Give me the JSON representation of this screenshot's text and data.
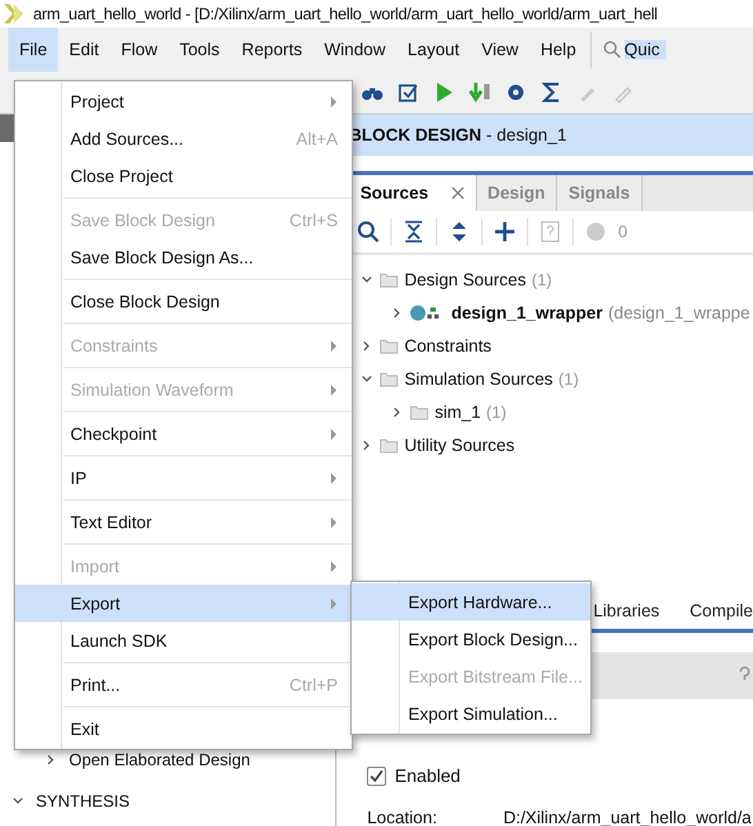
{
  "window": {
    "title": "arm_uart_hello_world - [D:/Xilinx/arm_uart_hello_world/arm_uart_hello_world/arm_uart_hell"
  },
  "menubar": [
    {
      "label": "File",
      "selected": true
    },
    {
      "label": "Edit",
      "selected": false
    },
    {
      "label": "Flow",
      "selected": false
    },
    {
      "label": "Tools",
      "selected": false
    },
    {
      "label": "Reports",
      "selected": false
    },
    {
      "label": "Window",
      "selected": false
    },
    {
      "label": "Layout",
      "selected": false
    },
    {
      "label": "View",
      "selected": false
    },
    {
      "label": "Help",
      "selected": false
    }
  ],
  "quick_access": {
    "placeholder": "Quic"
  },
  "flow_navigator": {
    "items": [
      {
        "label": "Open Elaborated Design",
        "kind": "task"
      },
      {
        "label": "SYNTHESIS",
        "kind": "section"
      }
    ]
  },
  "block_design_header": {
    "title": "BLOCK DESIGN",
    "name": "- design_1"
  },
  "sources_panel": {
    "tabs": [
      {
        "label": "Sources",
        "selected": true
      },
      {
        "label": "Design",
        "selected": false
      },
      {
        "label": "Signals",
        "selected": false
      }
    ],
    "error_count": "0",
    "tree": [
      {
        "label": "Design Sources",
        "count": "(1)",
        "expanded": true,
        "children": [
          {
            "label": "design_1_wrapper",
            "detail": "(design_1_wrappe",
            "kind": "module",
            "expanded": false
          }
        ]
      },
      {
        "label": "Constraints",
        "expanded": false
      },
      {
        "label": "Simulation Sources",
        "count": "(1)",
        "expanded": true,
        "children": [
          {
            "label": "sim_1",
            "count": "(1)",
            "kind": "folder",
            "expanded": false
          }
        ]
      },
      {
        "label": "Utility Sources",
        "expanded": false
      }
    ]
  },
  "lower_tabs": [
    {
      "label": "Libraries"
    },
    {
      "label": "Compile"
    }
  ],
  "properties": {
    "enabled": {
      "label": "Enabled",
      "checked": true
    },
    "location": {
      "label": "Location:",
      "value": "D:/Xilinx/arm_uart_hello_world/a"
    }
  },
  "file_menu": [
    {
      "label": "Project",
      "submenu": true,
      "disabled": false,
      "selected": false,
      "separator_before": false
    },
    {
      "label": "Add Sources...",
      "shortcut": "Alt+A",
      "submenu": false,
      "disabled": false,
      "selected": false,
      "separator_before": false
    },
    {
      "label": "Close Project",
      "submenu": false,
      "disabled": false,
      "selected": false,
      "separator_before": false
    },
    {
      "label": "Save Block Design",
      "shortcut": "Ctrl+S",
      "submenu": false,
      "disabled": true,
      "selected": false,
      "separator_before": true
    },
    {
      "label": "Save Block Design As...",
      "submenu": false,
      "disabled": false,
      "selected": false,
      "separator_before": false
    },
    {
      "label": "Close Block Design",
      "submenu": false,
      "disabled": false,
      "selected": false,
      "separator_before": true
    },
    {
      "label": "Constraints",
      "submenu": true,
      "disabled": true,
      "selected": false,
      "separator_before": true
    },
    {
      "label": "Simulation Waveform",
      "submenu": true,
      "disabled": true,
      "selected": false,
      "separator_before": true
    },
    {
      "label": "Checkpoint",
      "submenu": true,
      "disabled": false,
      "selected": false,
      "separator_before": true
    },
    {
      "label": "IP",
      "submenu": true,
      "disabled": false,
      "selected": false,
      "separator_before": true
    },
    {
      "label": "Text Editor",
      "submenu": true,
      "disabled": false,
      "selected": false,
      "separator_before": true
    },
    {
      "label": "Import",
      "submenu": true,
      "disabled": true,
      "selected": false,
      "separator_before": true
    },
    {
      "label": "Export",
      "submenu": true,
      "disabled": false,
      "selected": true,
      "separator_before": false
    },
    {
      "label": "Launch SDK",
      "submenu": false,
      "disabled": false,
      "selected": false,
      "separator_before": false
    },
    {
      "label": "Print...",
      "shortcut": "Ctrl+P",
      "submenu": false,
      "disabled": false,
      "selected": false,
      "separator_before": true
    },
    {
      "label": "Exit",
      "submenu": false,
      "disabled": false,
      "selected": false,
      "separator_before": true
    }
  ],
  "export_submenu": [
    {
      "label": "Export Hardware...",
      "disabled": false,
      "selected": true
    },
    {
      "label": "Export Block Design...",
      "disabled": false,
      "selected": false
    },
    {
      "label": "Export Bitstream File...",
      "disabled": true,
      "selected": false
    },
    {
      "label": "Export Simulation...",
      "disabled": false,
      "selected": false
    }
  ]
}
